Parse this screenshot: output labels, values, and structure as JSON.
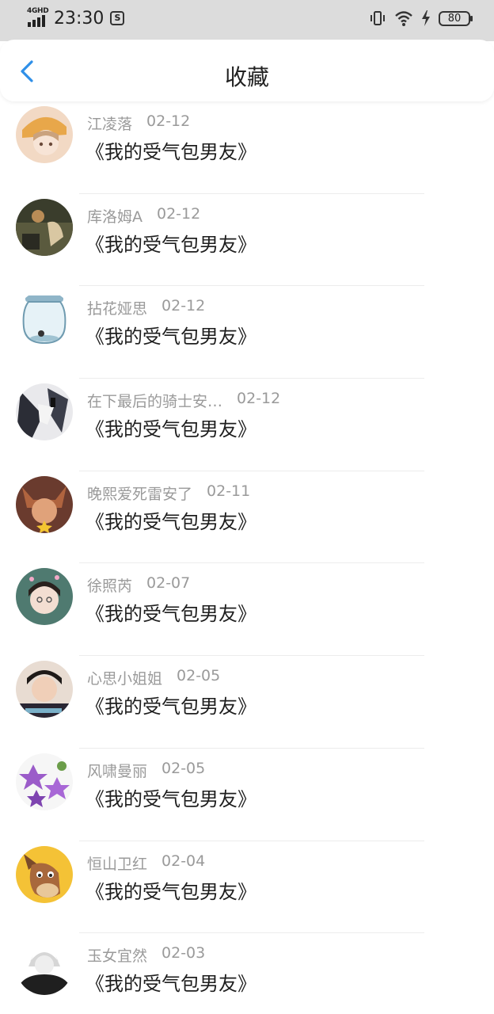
{
  "status_bar": {
    "network": "4GHD",
    "time": "23:30",
    "app_badge": "S",
    "battery": "80",
    "icons": [
      "vibrate-icon",
      "wifi-icon",
      "charging-icon",
      "battery-icon"
    ]
  },
  "header": {
    "title": "收藏",
    "back_icon": "chevron-left-icon",
    "accent": "#2f8fe8"
  },
  "favorites": [
    {
      "user": "江凌落",
      "date": "02-12",
      "book": "《我的受气包男友》"
    },
    {
      "user": "库洛姆A",
      "date": "02-12",
      "book": "《我的受气包男友》"
    },
    {
      "user": "拈花娅思",
      "date": "02-12",
      "book": "《我的受气包男友》"
    },
    {
      "user": "在下最后的骑士安…",
      "date": "02-12",
      "book": "《我的受气包男友》"
    },
    {
      "user": "晚熙爱死雷安了",
      "date": "02-11",
      "book": "《我的受气包男友》"
    },
    {
      "user": "徐照芮",
      "date": "02-07",
      "book": "《我的受气包男友》"
    },
    {
      "user": "心思小姐姐",
      "date": "02-05",
      "book": "《我的受气包男友》"
    },
    {
      "user": "风啸曼丽",
      "date": "02-05",
      "book": "《我的受气包男友》"
    },
    {
      "user": "恒山卫红",
      "date": "02-04",
      "book": "《我的受气包男友》"
    },
    {
      "user": "玉女宜然",
      "date": "02-03",
      "book": "《我的受气包男友》"
    }
  ]
}
